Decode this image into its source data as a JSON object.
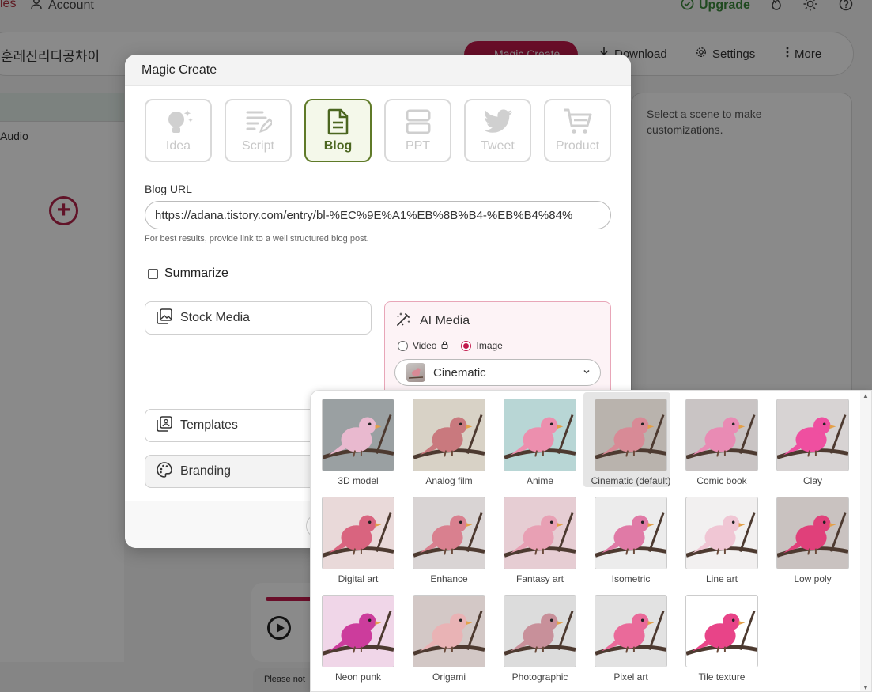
{
  "topnav": {
    "partial_label": "les",
    "account": "Account",
    "upgrade": "Upgrade"
  },
  "toolbar": {
    "project_title": "훈레진리디공차이",
    "magic_create": "Magic Create",
    "download": "Download",
    "settings": "Settings",
    "more": "More"
  },
  "left_column": {
    "audio_label": "Audio"
  },
  "right_panel": {
    "hint": "Select a scene to make customizations."
  },
  "note": {
    "text": "Please not"
  },
  "modal": {
    "title": "Magic Create",
    "types": [
      {
        "label": "Idea",
        "icon": "lightbulb-icon",
        "active": false
      },
      {
        "label": "Script",
        "icon": "script-icon",
        "active": false
      },
      {
        "label": "Blog",
        "icon": "document-icon",
        "active": true
      },
      {
        "label": "PPT",
        "icon": "slides-icon",
        "active": false
      },
      {
        "label": "Tweet",
        "icon": "twitter-icon",
        "active": false
      },
      {
        "label": "Product",
        "icon": "cart-icon",
        "active": false
      }
    ],
    "blog_url_label": "Blog URL",
    "blog_url_value": "https://adana.tistory.com/entry/bl-%EC%9E%A1%EB%8B%B4-%EB%B4%84%",
    "helper": "For best results, provide link to a well structured blog post.",
    "summarize_label": "Summarize",
    "stock_media": "Stock Media",
    "ai_media": {
      "title": "AI Media",
      "video_label": "Video",
      "image_label": "Image",
      "selected_style": "Cinematic"
    },
    "templates": "Templates",
    "branding": "Branding"
  },
  "styles": [
    {
      "name": "3D model",
      "color": "#e9b9cf",
      "bg": "#9aa0a2"
    },
    {
      "name": "Analog film",
      "color": "#c9797e",
      "bg": "#d8d2c6"
    },
    {
      "name": "Anime",
      "color": "#ec8fae",
      "bg": "#b8d6d5"
    },
    {
      "name": "Cinematic (default)",
      "color": "#d88a96",
      "bg": "#b9b3ad",
      "selected": true
    },
    {
      "name": "Comic book",
      "color": "#e98bb4",
      "bg": "#c9c4c4"
    },
    {
      "name": "Clay",
      "color": "#ef4fa0",
      "bg": "#d7d3d3"
    },
    {
      "name": "Digital art",
      "color": "#d9647f",
      "bg": "#e9d9d9"
    },
    {
      "name": "Enhance",
      "color": "#d9808f",
      "bg": "#d9d4d4"
    },
    {
      "name": "Fantasy art",
      "color": "#e8a0b4",
      "bg": "#e6cdd3"
    },
    {
      "name": "Isometric",
      "color": "#e07aa6",
      "bg": "#ececec"
    },
    {
      "name": "Line art",
      "color": "#f0c6d4",
      "bg": "#f2f0f0"
    },
    {
      "name": "Low poly",
      "color": "#e0407a",
      "bg": "#c9c2c0"
    },
    {
      "name": "Neon punk",
      "color": "#cc3c9c",
      "bg": "#f0d6e8"
    },
    {
      "name": "Origami",
      "color": "#e9b3b5",
      "bg": "#d3c8c6"
    },
    {
      "name": "Photographic",
      "color": "#c8909a",
      "bg": "#dcdcdc"
    },
    {
      "name": "Pixel art",
      "color": "#ea6a9a",
      "bg": "#e2e2e2"
    },
    {
      "name": "Tile texture",
      "color": "#e84488",
      "bg": "#ffffff"
    }
  ],
  "colors": {
    "accent": "#c21a4c",
    "blog_active": "#5f7a28",
    "upgrade": "#3c8a3c"
  }
}
